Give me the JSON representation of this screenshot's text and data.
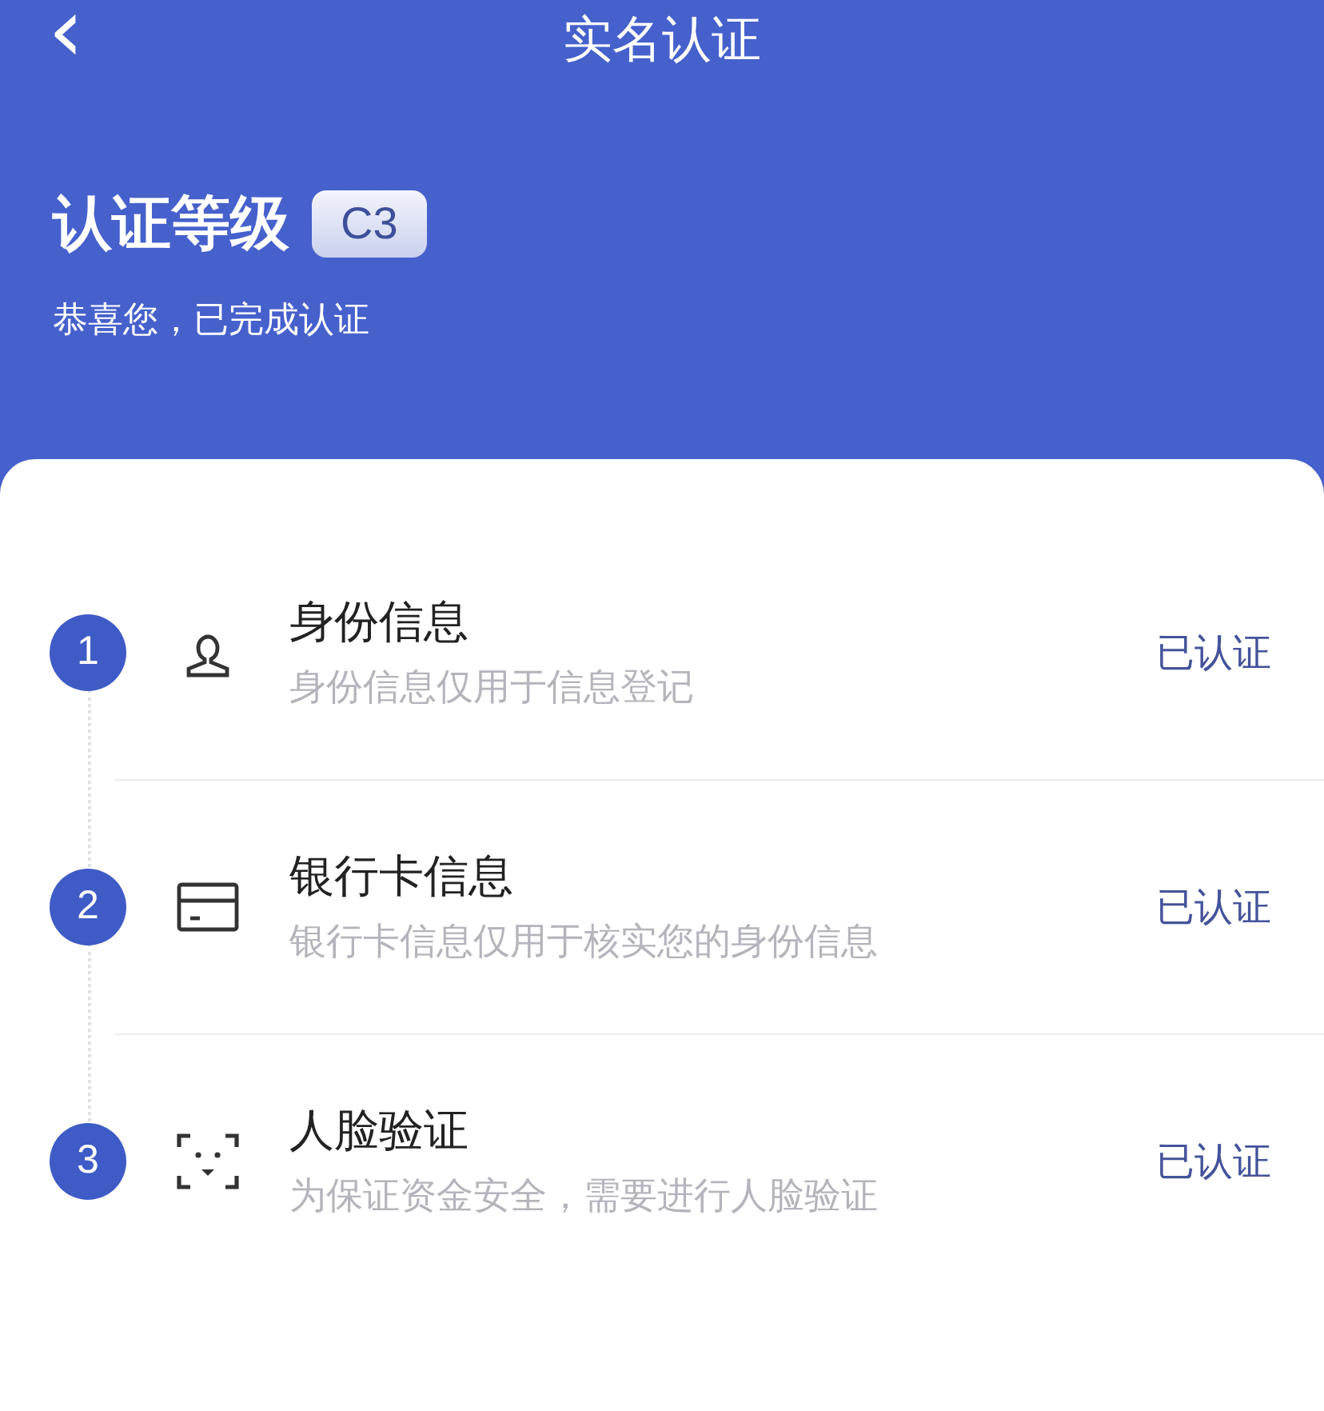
{
  "header": {
    "back_icon": "‹",
    "title": "实名认证"
  },
  "level": {
    "label": "认证等级",
    "badge": "C3",
    "message": "恭喜您，已完成认证"
  },
  "steps": [
    {
      "number": "1",
      "kind": "person",
      "title": "身份信息",
      "description": "身份信息仅用于信息登记",
      "status": "已认证"
    },
    {
      "number": "2",
      "kind": "card",
      "title": "银行卡信息",
      "description": "银行卡信息仅用于核实您的身份信息",
      "status": "已认证"
    },
    {
      "number": "3",
      "kind": "face",
      "title": "人脸验证",
      "description": "为保证资金安全，需要进行人脸验证",
      "status": "已认证"
    }
  ]
}
